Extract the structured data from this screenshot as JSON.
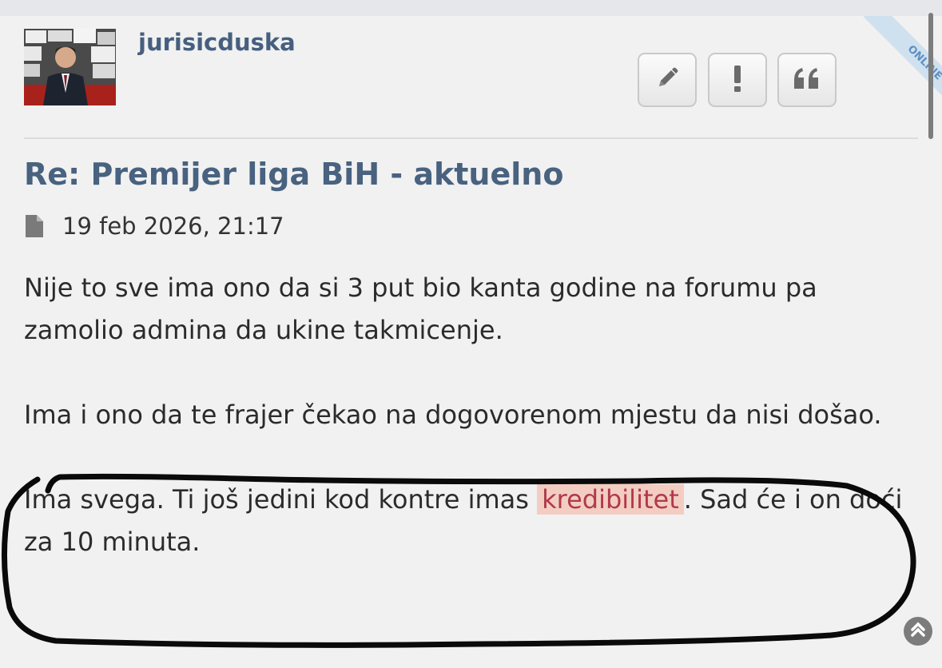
{
  "post": {
    "username": "jurisicduska",
    "online_label": "ONLINE",
    "title": "Re: Premijer liga BiH - aktuelno",
    "timestamp": "19 feb 2026, 21:17",
    "paragraphs": [
      "Nije to sve ima ono da si 3 put bio kanta godine na forumu pa zamolio admina da ukine takmicenje.",
      "Ima i ono da te frajer čekao na dogovorenom mjestu da nisi došao."
    ],
    "last_paragraph": {
      "before": "Ima svega. Ti još jedini kod kontre imas ",
      "highlight": "kredibilitet",
      "after": ". Sad će i on doći za 10 minuta."
    }
  },
  "actions": {
    "edit_icon": "pencil-icon",
    "report_icon": "exclamation-icon",
    "quote_icon": "quote-icon"
  },
  "colors": {
    "username": "#465f7f",
    "title": "#48627f",
    "highlight_bg": "#f3cdc2",
    "highlight_text": "#b03a4a",
    "annotation": "#0a0a0a"
  }
}
